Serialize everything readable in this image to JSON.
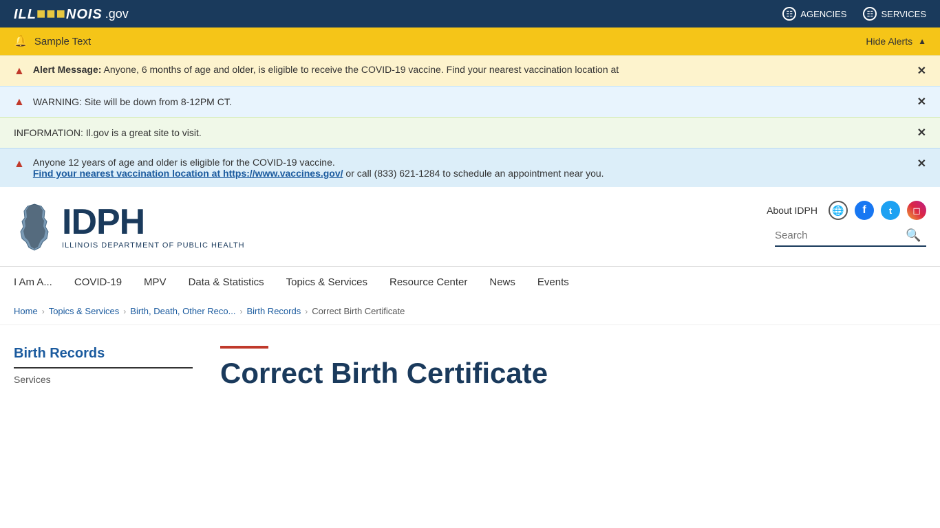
{
  "topbar": {
    "logo_ill": "ILL",
    "logo_dots": "···",
    "logo_nois": "NOIS",
    "logo_gov": ".gov",
    "agencies_label": "AGENCIES",
    "services_label": "SERVICES"
  },
  "alerts": {
    "hide_label": "Hide Alerts",
    "sample_text": "Sample Text",
    "alert1": {
      "label": "Alert Message:",
      "text": " Anyone, 6 months of age and older, is eligible to receive the COVID-19 vaccine. Find your nearest vaccination location at"
    },
    "alert2": {
      "text": "WARNING: Site will be down from 8-12PM CT."
    },
    "alert3": {
      "text": "INFORMATION: Il.gov is a great site to visit."
    },
    "alert4": {
      "text": "Anyone 12 years of age and older is eligible for the COVID-19 vaccine.",
      "link_text": "Find your nearest vaccination location at https://www.vaccines.gov/",
      "link_suffix": " or call (833) 621-1284 to schedule an appointment near you."
    }
  },
  "header": {
    "idph_text": "IDPH",
    "subtitle": "Illinois Department of Public Health",
    "about_label": "About IDPH",
    "search_placeholder": "Search"
  },
  "nav": {
    "items": [
      {
        "label": "I Am A..."
      },
      {
        "label": "COVID-19"
      },
      {
        "label": "MPV"
      },
      {
        "label": "Data & Statistics"
      },
      {
        "label": "Topics & Services"
      },
      {
        "label": "Resource Center"
      },
      {
        "label": "News"
      },
      {
        "label": "Events"
      }
    ]
  },
  "breadcrumb": {
    "items": [
      {
        "label": "Home",
        "link": true
      },
      {
        "label": "Topics & Services",
        "link": true
      },
      {
        "label": "Birth, Death, Other Reco...",
        "link": true
      },
      {
        "label": "Birth Records",
        "link": true
      },
      {
        "label": "Correct Birth Certificate",
        "link": false
      }
    ]
  },
  "sidebar": {
    "title": "Birth Records",
    "sub_label": "Services"
  },
  "content": {
    "red_bar": true,
    "page_title": "Correct Birth Certificate"
  },
  "social": {
    "globe_icon": "🌐",
    "facebook_icon": "f",
    "twitter_icon": "t",
    "instagram_icon": "◻"
  }
}
